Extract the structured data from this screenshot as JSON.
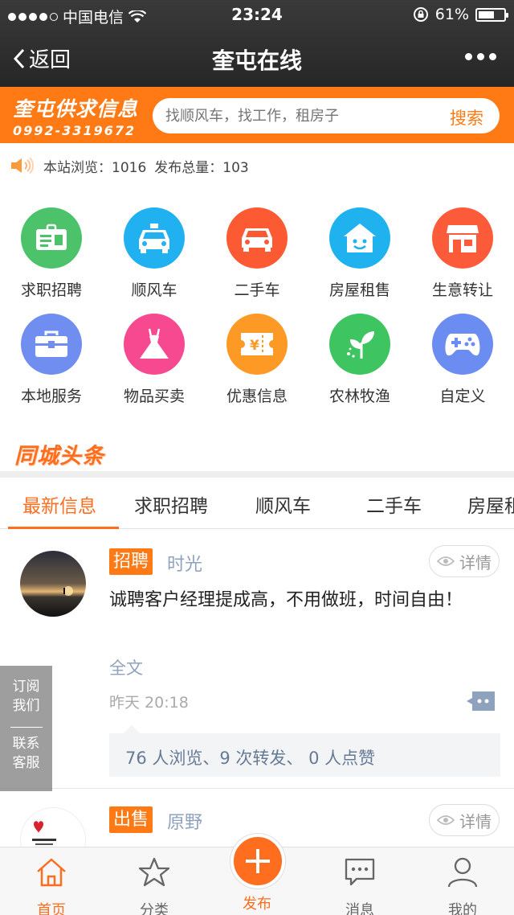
{
  "status_bar": {
    "carrier": "中国电信",
    "time": "23:24",
    "battery": "61%"
  },
  "nav": {
    "back_label": "返回",
    "title": "奎屯在线"
  },
  "banner": {
    "brand_name": "奎屯供求信息",
    "brand_phone": "0992-3319672",
    "search_placeholder": "找顺风车，找工作，租房子",
    "search_button": "搜索"
  },
  "stats": {
    "views_label": "本站浏览：",
    "views": "1016",
    "posts_label": "发布总量：",
    "posts": "103"
  },
  "categories": [
    {
      "label": "求职招聘",
      "icon": "id-card-icon",
      "color": "#4cc36b"
    },
    {
      "label": "顺风车",
      "icon": "taxi-icon",
      "color": "#21b0f0"
    },
    {
      "label": "二手车",
      "icon": "car-icon",
      "color": "#fb5a32"
    },
    {
      "label": "房屋租售",
      "icon": "house-icon",
      "color": "#1fb2ee"
    },
    {
      "label": "生意转让",
      "icon": "shop-icon",
      "color": "#fb5b38"
    },
    {
      "label": "本地服务",
      "icon": "toolbox-icon",
      "color": "#6f8ef0"
    },
    {
      "label": "物品买卖",
      "icon": "dress-icon",
      "color": "#f7498f"
    },
    {
      "label": "优惠信息",
      "icon": "coupon-icon",
      "color": "#fd9a26"
    },
    {
      "label": "农林牧渔",
      "icon": "sprout-icon",
      "color": "#3ec561"
    },
    {
      "label": "自定义",
      "icon": "gamepad-icon",
      "color": "#6b8cf0"
    }
  ],
  "headline_title": "同城头条",
  "tabs": [
    "最新信息",
    "求职招聘",
    "顺风车",
    "二手车",
    "房屋租"
  ],
  "posts": [
    {
      "tag": "招聘",
      "user": "时光",
      "detail": "详情",
      "text": "诚聘客户经理提成高，不用做班，时间自由！",
      "full": "全文",
      "time": "昨天 20:18",
      "stats": "76 人浏览、9 次转发、 0 人点赞"
    },
    {
      "tag": "出售",
      "user": "原野",
      "detail": "详情"
    }
  ],
  "side": {
    "subscribe": "订阅我们",
    "contact": "联系客服"
  },
  "bottom_nav": [
    {
      "label": "首页",
      "icon": "home-icon"
    },
    {
      "label": "分类",
      "icon": "star-icon"
    },
    {
      "label": "发布",
      "icon": "plus-icon"
    },
    {
      "label": "消息",
      "icon": "message-icon"
    },
    {
      "label": "我的",
      "icon": "user-icon"
    }
  ],
  "colors": {
    "accent": "#ff7a14",
    "link": "#8fa2bd"
  }
}
